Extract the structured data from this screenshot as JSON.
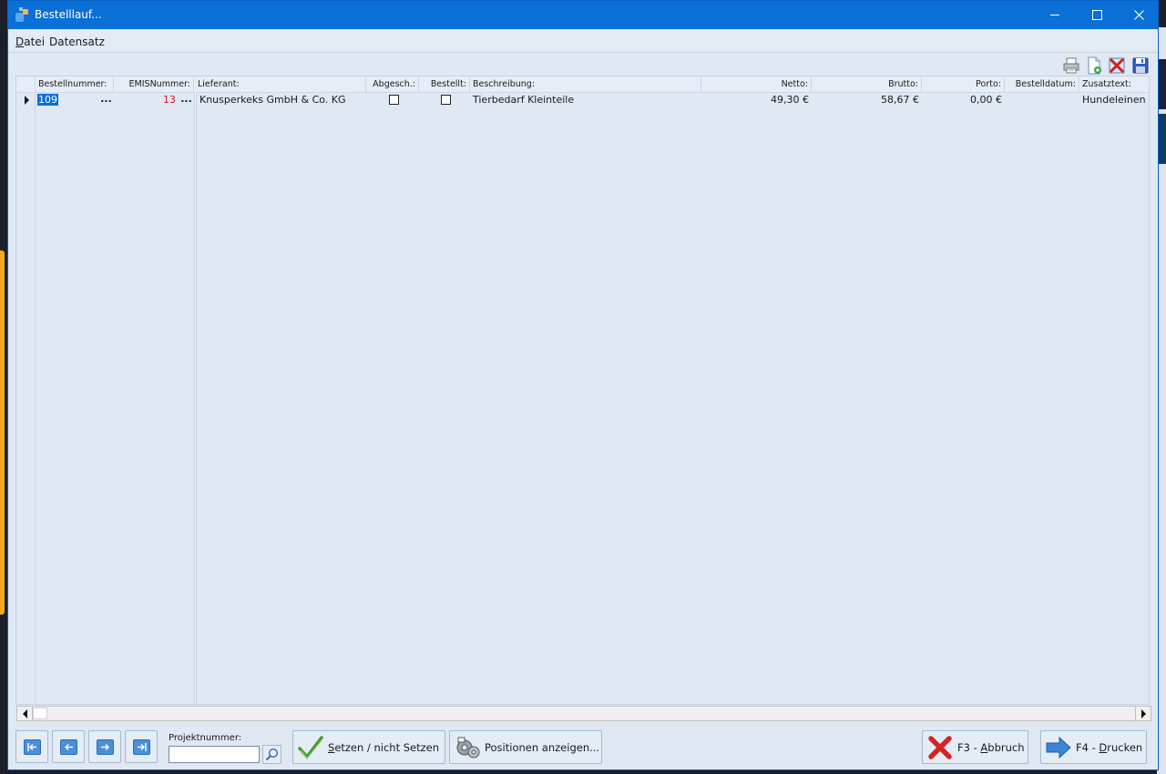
{
  "window": {
    "title": "Bestelllauf...",
    "controls": {
      "minimize": "minimize",
      "maximize": "maximize",
      "close": "close"
    }
  },
  "menu": {
    "datei": {
      "accel": "D",
      "rest": "atei"
    },
    "datensatz": "Datensatz"
  },
  "toolbar": {
    "icons": [
      "printer-icon",
      "new-record-icon",
      "delete-record-icon",
      "save-icon"
    ]
  },
  "grid": {
    "columns": {
      "bestellnummer": "Bestellnummer:",
      "emisnummer": "EMISNummer:",
      "lieferant": "Lieferant:",
      "abgeschlossen": "Abgesch.:",
      "bestellt": "Bestellt:",
      "beschreibung": "Beschreibung:",
      "netto": "Netto:",
      "brutto": "Brutto:",
      "porto": "Porto:",
      "bestelldatum": "Bestelldatum:",
      "zusatztext": "Zusatztext:"
    },
    "rows": [
      {
        "bestellnummer": "109",
        "emisnummer": "13",
        "ellipsis": "...",
        "lieferant": "Knusperkeks GmbH & Co. KG",
        "abgeschlossen": false,
        "bestellt": false,
        "beschreibung": "Tierbedarf Kleinteile",
        "netto": "49,30 €",
        "brutto": "58,67 €",
        "porto": "0,00 €",
        "bestelldatum": "",
        "zusatztext": "Hundeleinen"
      }
    ]
  },
  "footer": {
    "nav": [
      "first-record",
      "previous-record",
      "next-record",
      "last-record"
    ],
    "projekt_label": "Projektnummer:",
    "projekt_value": "",
    "setzen": {
      "accel": "S",
      "rest": "etzen / nicht Setzen"
    },
    "positionen": "Positionen anzeigen...",
    "abbruch": {
      "pre": "F3 - ",
      "accel": "A",
      "rest": "bbruch"
    },
    "drucken": {
      "pre": "F4 - ",
      "accel": "D",
      "rest": "rucken"
    }
  },
  "colors": {
    "titlebar": "#0a6fd6",
    "window_bg": "#dfe8f3",
    "selection": "#0a6fd6",
    "emis_text": "#d11a1a"
  }
}
